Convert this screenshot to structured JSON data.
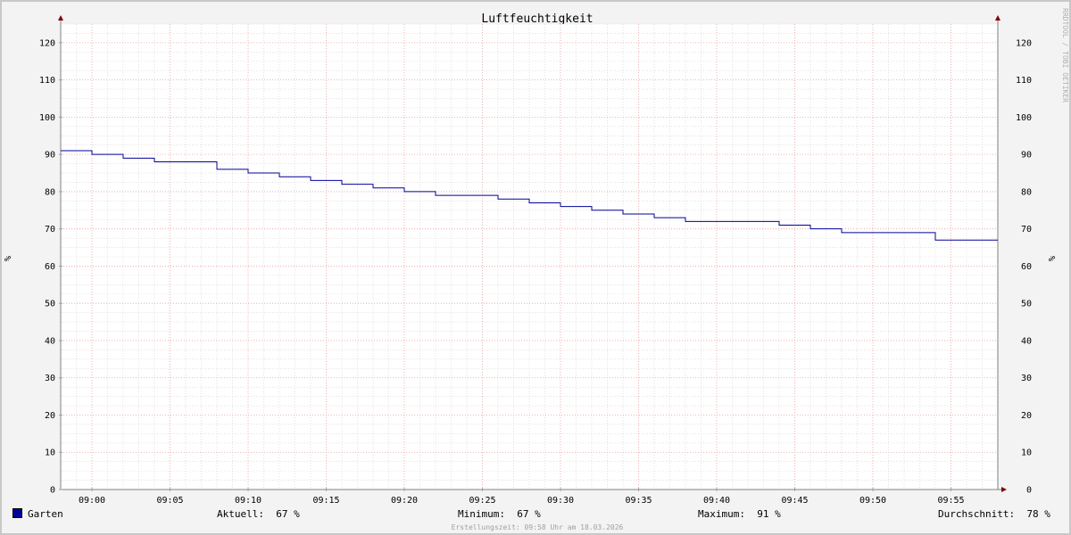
{
  "watermark": "RRDTOOL / TOBI OETIKER",
  "legend": {
    "series_name": "Garten",
    "series_color": "#000099",
    "current_label": "Aktuell:",
    "current_value": "67 %",
    "min_label": "Minimum:",
    "min_value": "67 %",
    "max_label": "Maximum:",
    "max_value": "91 %",
    "avg_label": "Durchschnitt:",
    "avg_value": "78 %"
  },
  "footer": "Erstellungszeit: 09:58 Uhr am 18.03.2026",
  "colors": {
    "background": "#f3f3f3",
    "plot_background": "#ffffff",
    "major_grid": "#e8a0a0",
    "minor_grid": "#d0d0d0",
    "axis_arrow": "#800000",
    "line": "#000099"
  },
  "chart_data": {
    "type": "line",
    "step": true,
    "title": "Luftfeuchtigkeit",
    "ylabel": "%",
    "ylabel_right": "%",
    "ylim": [
      0,
      125
    ],
    "xlim": [
      "08:58",
      "09:58"
    ],
    "y_ticks": [
      0,
      10,
      20,
      30,
      40,
      50,
      60,
      70,
      80,
      90,
      100,
      110,
      120
    ],
    "x_ticks": [
      "09:00",
      "09:05",
      "09:10",
      "09:15",
      "09:20",
      "09:25",
      "09:30",
      "09:35",
      "09:40",
      "09:45",
      "09:50",
      "09:55"
    ],
    "grid": true,
    "series": [
      {
        "name": "Garten",
        "color": "#000099",
        "points": [
          {
            "x": "08:58",
            "y": 91
          },
          {
            "x": "09:00",
            "y": 90
          },
          {
            "x": "09:02",
            "y": 89
          },
          {
            "x": "09:04",
            "y": 88
          },
          {
            "x": "09:08",
            "y": 86
          },
          {
            "x": "09:10",
            "y": 85
          },
          {
            "x": "09:12",
            "y": 84
          },
          {
            "x": "09:14",
            "y": 83
          },
          {
            "x": "09:16",
            "y": 82
          },
          {
            "x": "09:18",
            "y": 81
          },
          {
            "x": "09:20",
            "y": 80
          },
          {
            "x": "09:22",
            "y": 79
          },
          {
            "x": "09:26",
            "y": 78
          },
          {
            "x": "09:28",
            "y": 77
          },
          {
            "x": "09:30",
            "y": 76
          },
          {
            "x": "09:32",
            "y": 75
          },
          {
            "x": "09:34",
            "y": 74
          },
          {
            "x": "09:36",
            "y": 73
          },
          {
            "x": "09:38",
            "y": 72
          },
          {
            "x": "09:44",
            "y": 71
          },
          {
            "x": "09:46",
            "y": 70
          },
          {
            "x": "09:48",
            "y": 69
          },
          {
            "x": "09:54",
            "y": 67
          },
          {
            "x": "09:58",
            "y": 67
          }
        ]
      }
    ]
  }
}
